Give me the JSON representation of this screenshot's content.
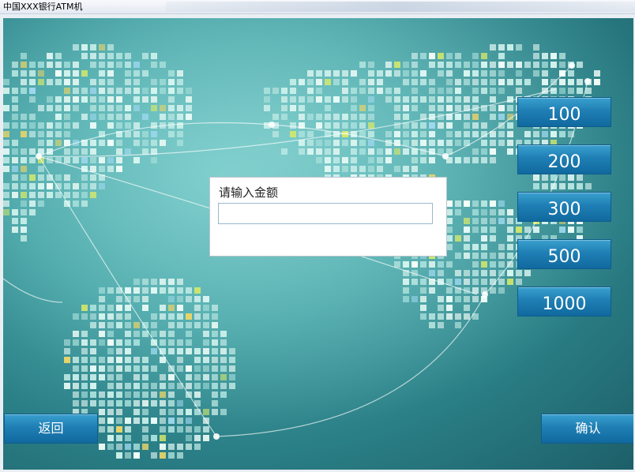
{
  "window": {
    "title": "中国XXX银行ATM机"
  },
  "dialog": {
    "prompt": "请输入金额",
    "amount_value": ""
  },
  "amount_buttons": [
    "100",
    "200",
    "300",
    "500",
    "1000"
  ],
  "bottom_buttons": {
    "back": "返回",
    "confirm": "确认"
  },
  "colors": {
    "button_top": "#3aa0cf",
    "button_bottom": "#10699f",
    "background_teal": "#4aa6a8"
  }
}
